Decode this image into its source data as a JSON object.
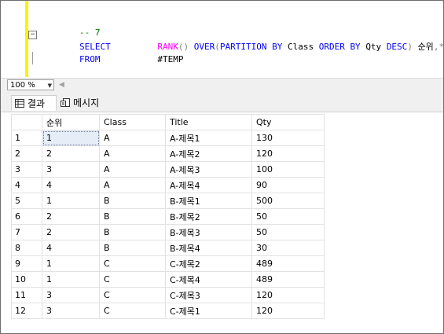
{
  "editor": {
    "line_comment": "-- 7",
    "line_select_kw": "SELECT",
    "line_select_fn": "RANK",
    "line_select_paren1": "()",
    "line_select_over": "OVER",
    "line_select_open": "(",
    "line_select_partition": "PARTITION BY",
    "line_select_class": "Class",
    "line_select_order": "ORDER BY",
    "line_select_qty": "Qty",
    "line_select_desc": "DESC",
    "line_select_close": ")",
    "line_select_alias": "순위",
    "line_select_comma": ",",
    "line_select_star": "*",
    "line_from_kw": "FROM",
    "line_from_table": "#TEMP"
  },
  "zoom": {
    "value": "100 %"
  },
  "tabs": [
    {
      "label": "결과",
      "icon": "grid-icon"
    },
    {
      "label": "메시지",
      "icon": "messages-icon"
    }
  ],
  "grid": {
    "columns": [
      "",
      "순위",
      "Class",
      "Title",
      "Qty"
    ],
    "rows": [
      [
        "1",
        "1",
        "A",
        "A-제목1",
        "130"
      ],
      [
        "2",
        "2",
        "A",
        "A-제목2",
        "120"
      ],
      [
        "3",
        "3",
        "A",
        "A-제목3",
        "100"
      ],
      [
        "4",
        "4",
        "A",
        "A-제목4",
        "90"
      ],
      [
        "5",
        "1",
        "B",
        "B-제목1",
        "500"
      ],
      [
        "6",
        "2",
        "B",
        "B-제목2",
        "50"
      ],
      [
        "7",
        "2",
        "B",
        "B-제목3",
        "50"
      ],
      [
        "8",
        "4",
        "B",
        "B-제목4",
        "30"
      ],
      [
        "9",
        "1",
        "C",
        "C-제목2",
        "489"
      ],
      [
        "10",
        "1",
        "C",
        "C-제목4",
        "489"
      ],
      [
        "11",
        "3",
        "C",
        "C-제목3",
        "120"
      ],
      [
        "12",
        "3",
        "C",
        "C-제목1",
        "120"
      ]
    ]
  },
  "colors": {
    "comment": "#008000",
    "keyword": "#0000ff",
    "function": "#ff00ff",
    "operator": "#808080",
    "changed_margin": "#fff200",
    "selected_cell": "#e6edf7"
  }
}
